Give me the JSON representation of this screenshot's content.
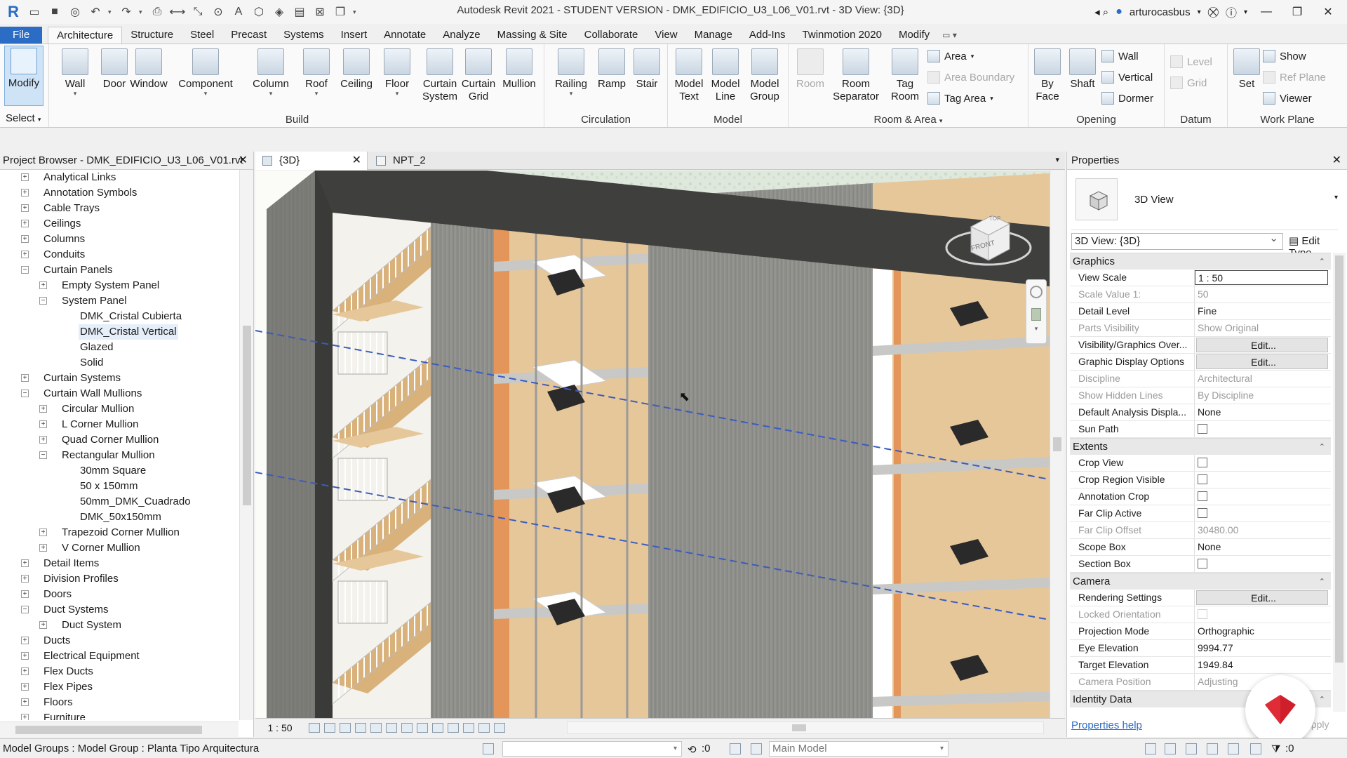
{
  "titlebar": {
    "title": "Autodesk Revit 2021 - STUDENT VERSION - DMK_EDIFICIO_U3_L06_V01.rvt - 3D View: {3D}",
    "user": "arturocasbus",
    "logo": "R"
  },
  "tabs": [
    "File",
    "Architecture",
    "Structure",
    "Steel",
    "Precast",
    "Systems",
    "Insert",
    "Annotate",
    "Analyze",
    "Massing & Site",
    "Collaborate",
    "View",
    "Manage",
    "Add-Ins",
    "Twinmotion 2020",
    "Modify"
  ],
  "ribbon": {
    "modify": "Modify",
    "select": "Select",
    "build": {
      "label": "Build",
      "buttons": [
        "Wall",
        "Door",
        "Window",
        "Component",
        "Column",
        "Roof",
        "Ceiling",
        "Floor",
        "Curtain System",
        "Curtain Grid",
        "Mullion"
      ]
    },
    "circulation": {
      "label": "Circulation",
      "buttons": [
        "Railing",
        "Ramp",
        "Stair"
      ]
    },
    "model": {
      "label": "Model",
      "buttons": [
        "Model Text",
        "Model Line",
        "Model Group"
      ]
    },
    "room_area": {
      "label": "Room & Area",
      "buttons": [
        "Room",
        "Room Separator",
        "Tag Room"
      ],
      "small": [
        "Area",
        "Area Boundary",
        "Tag Area"
      ]
    },
    "opening": {
      "label": "Opening",
      "buttons": [
        "By Face",
        "Shaft"
      ],
      "small": [
        "Wall",
        "Vertical",
        "Dormer"
      ]
    },
    "datum": {
      "label": "Datum",
      "small": [
        "Level",
        "Grid"
      ]
    },
    "work_plane": {
      "label": "Work Plane",
      "buttons": [
        "Set"
      ],
      "small": [
        "Show",
        "Ref Plane",
        "Viewer"
      ]
    }
  },
  "browser": {
    "title": "Project Browser - DMK_EDIFICIO_U3_L06_V01.rvt",
    "items": [
      {
        "label": "Analytical Links",
        "level": 0,
        "toggle": "+"
      },
      {
        "label": "Annotation Symbols",
        "level": 0,
        "toggle": "+"
      },
      {
        "label": "Cable Trays",
        "level": 0,
        "toggle": "+"
      },
      {
        "label": "Ceilings",
        "level": 0,
        "toggle": "+"
      },
      {
        "label": "Columns",
        "level": 0,
        "toggle": "+"
      },
      {
        "label": "Conduits",
        "level": 0,
        "toggle": "+"
      },
      {
        "label": "Curtain Panels",
        "level": 0,
        "toggle": "−"
      },
      {
        "label": "Empty System Panel",
        "level": 1,
        "toggle": "+"
      },
      {
        "label": "System Panel",
        "level": 1,
        "toggle": "−"
      },
      {
        "label": "DMK_Cristal Cubierta",
        "level": 2,
        "toggle": ""
      },
      {
        "label": "DMK_Cristal Vertical",
        "level": 2,
        "toggle": "",
        "selected": true
      },
      {
        "label": "Glazed",
        "level": 2,
        "toggle": ""
      },
      {
        "label": "Solid",
        "level": 2,
        "toggle": ""
      },
      {
        "label": "Curtain Systems",
        "level": 0,
        "toggle": "+"
      },
      {
        "label": "Curtain Wall Mullions",
        "level": 0,
        "toggle": "−"
      },
      {
        "label": "Circular Mullion",
        "level": 1,
        "toggle": "+"
      },
      {
        "label": "L Corner Mullion",
        "level": 1,
        "toggle": "+"
      },
      {
        "label": "Quad Corner Mullion",
        "level": 1,
        "toggle": "+"
      },
      {
        "label": "Rectangular Mullion",
        "level": 1,
        "toggle": "−"
      },
      {
        "label": "30mm Square",
        "level": 2,
        "toggle": ""
      },
      {
        "label": "50 x 150mm",
        "level": 2,
        "toggle": ""
      },
      {
        "label": "50mm_DMK_Cuadrado",
        "level": 2,
        "toggle": ""
      },
      {
        "label": "DMK_50x150mm",
        "level": 2,
        "toggle": ""
      },
      {
        "label": "Trapezoid Corner Mullion",
        "level": 1,
        "toggle": "+"
      },
      {
        "label": "V Corner Mullion",
        "level": 1,
        "toggle": "+"
      },
      {
        "label": "Detail Items",
        "level": 0,
        "toggle": "+"
      },
      {
        "label": "Division Profiles",
        "level": 0,
        "toggle": "+"
      },
      {
        "label": "Doors",
        "level": 0,
        "toggle": "+"
      },
      {
        "label": "Duct Systems",
        "level": 0,
        "toggle": "−"
      },
      {
        "label": "Duct System",
        "level": 1,
        "toggle": "+"
      },
      {
        "label": "Ducts",
        "level": 0,
        "toggle": "+"
      },
      {
        "label": "Electrical Equipment",
        "level": 0,
        "toggle": "+"
      },
      {
        "label": "Flex Ducts",
        "level": 0,
        "toggle": "+"
      },
      {
        "label": "Flex Pipes",
        "level": 0,
        "toggle": "+"
      },
      {
        "label": "Floors",
        "level": 0,
        "toggle": "+"
      },
      {
        "label": "Furniture",
        "level": 0,
        "toggle": "+"
      }
    ]
  },
  "view_tabs": [
    {
      "label": "{3D}",
      "active": true
    },
    {
      "label": "NPT_2",
      "active": false
    }
  ],
  "viewcube": {
    "top": "TOP",
    "front": "FRONT"
  },
  "view_bar": {
    "scale": "1 : 50"
  },
  "properties": {
    "title": "Properties",
    "type_name": "3D View",
    "instance": "3D View: {3D}",
    "edit_type": "Edit Type",
    "help": "Properties help",
    "apply": "Apply",
    "categories": [
      {
        "name": "Graphics",
        "rows": [
          {
            "k": "View Scale",
            "v": "1 : 50",
            "kind": "edit"
          },
          {
            "k": "Scale Value    1:",
            "v": "50",
            "ro": true
          },
          {
            "k": "Detail Level",
            "v": "Fine"
          },
          {
            "k": "Parts Visibility",
            "v": "Show Original",
            "ro": true
          },
          {
            "k": "Visibility/Graphics Over...",
            "v": "Edit...",
            "kind": "btn"
          },
          {
            "k": "Graphic Display Options",
            "v": "Edit...",
            "kind": "btn"
          },
          {
            "k": "Discipline",
            "v": "Architectural",
            "ro": true
          },
          {
            "k": "Show Hidden Lines",
            "v": "By Discipline",
            "ro": true
          },
          {
            "k": "Default Analysis Displa...",
            "v": "None"
          },
          {
            "k": "Sun Path",
            "v": "",
            "kind": "check"
          }
        ]
      },
      {
        "name": "Extents",
        "rows": [
          {
            "k": "Crop View",
            "v": "",
            "kind": "check"
          },
          {
            "k": "Crop Region Visible",
            "v": "",
            "kind": "check"
          },
          {
            "k": "Annotation Crop",
            "v": "",
            "kind": "check"
          },
          {
            "k": "Far Clip Active",
            "v": "",
            "kind": "check"
          },
          {
            "k": "Far Clip Offset",
            "v": "30480.00",
            "ro": true
          },
          {
            "k": "Scope Box",
            "v": "None"
          },
          {
            "k": "Section Box",
            "v": "",
            "kind": "check"
          }
        ]
      },
      {
        "name": "Camera",
        "rows": [
          {
            "k": "Rendering Settings",
            "v": "Edit...",
            "kind": "btn"
          },
          {
            "k": "Locked Orientation",
            "v": "",
            "kind": "check",
            "ro": true
          },
          {
            "k": "Projection Mode",
            "v": "Orthographic"
          },
          {
            "k": "Eye Elevation",
            "v": "9994.77"
          },
          {
            "k": "Target Elevation",
            "v": "1949.84"
          },
          {
            "k": "Camera Position",
            "v": "Adjusting",
            "ro": true
          }
        ]
      },
      {
        "name": "Identity Data",
        "rows": []
      }
    ]
  },
  "status": {
    "message": "Model Groups : Model Group : Planta Tipo Arquitectura",
    "count_left": ":0",
    "model": "Main Model",
    "filter_count": ":0"
  },
  "colors": {
    "accent": "#2b6cc4",
    "wood": "#e6c79a",
    "concrete": "#8f8f8c",
    "dark": "#3a3a38"
  }
}
